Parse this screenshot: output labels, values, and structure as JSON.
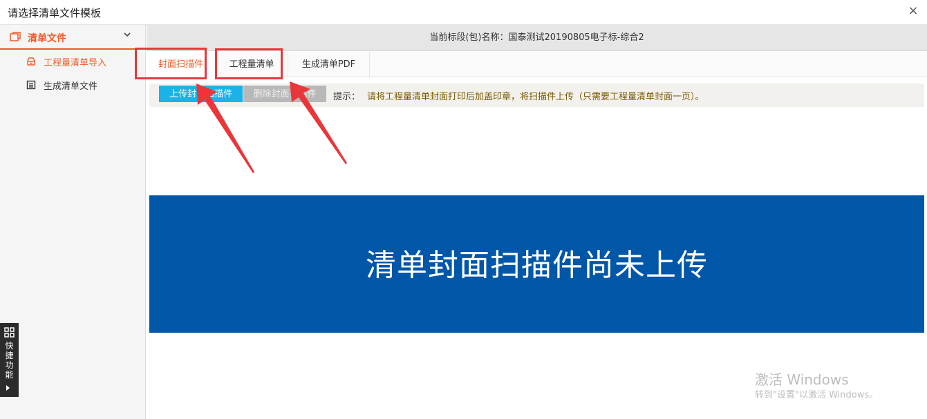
{
  "window": {
    "title": "请选择清单文件模板",
    "close_icon": "×"
  },
  "sidebar": {
    "header": {
      "label": "清单文件",
      "icon": "folder-icon",
      "chevron": "⌄"
    },
    "items": [
      {
        "label": "工程量清单导入",
        "icon": "import-icon",
        "active": true
      },
      {
        "label": "生成清单文件",
        "icon": "list-file-icon",
        "active": false
      }
    ],
    "quick_function": {
      "label": "快捷功能",
      "icon": "grid-icon"
    }
  },
  "main": {
    "info": "当前标段(包)名称：国泰测试20190805电子标-综合2",
    "tabs": [
      {
        "label": "封面扫描件",
        "active": true
      },
      {
        "label": "工程量清单",
        "active": false
      },
      {
        "label": "生成清单PDF",
        "active": false
      }
    ],
    "toolbar": {
      "upload_label": "上传封面扫描件",
      "delete_label": "删除封面扫描件",
      "hint_label": "提示：",
      "hint_text": "请将工程量清单封面打印后加盖印章，将扫描件上传（只需要工程量清单封面一页）。"
    },
    "banner_text": "清单封面扫描件尚未上传"
  },
  "watermark": {
    "line1": "激活 Windows",
    "line2": "转到\"设置\"以激活 Windows。"
  },
  "colors": {
    "accent": "#f05a28",
    "banner": "#0057a8",
    "upload": "#1ab2e8",
    "annotation": "#e8373b"
  }
}
